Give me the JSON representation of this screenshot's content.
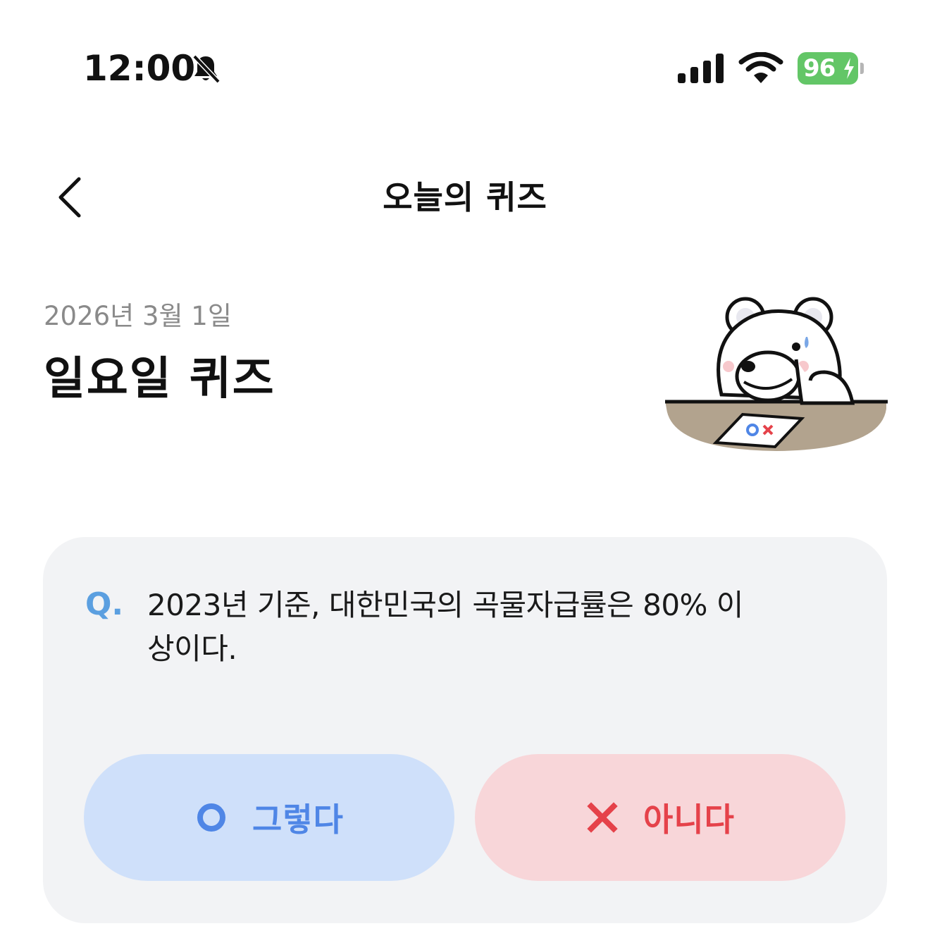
{
  "status_bar": {
    "time": "12:00",
    "battery_percent": "96",
    "icons": [
      "bell-slash-icon",
      "cellular-signal-icon",
      "wifi-icon",
      "battery-charging-icon"
    ],
    "battery_color": "#63c667"
  },
  "header": {
    "title": "오늘의 퀴즈",
    "back_icon": "chevron-left-icon"
  },
  "quiz": {
    "date": "2026년 3월 1일",
    "title": "일요일 퀴즈",
    "mascot_icon": "polar-bear-mascot",
    "question_prefix": "Q.",
    "question": "2023년 기준, 대한민국의 곡물자급률은 80% 이상이다.",
    "options": [
      {
        "icon": "circle-o-icon",
        "label": "그렇다",
        "color": "#4f86e6",
        "background": "#cfe0fa"
      },
      {
        "icon": "x-mark-icon",
        "label": "아니다",
        "color": "#e5424a",
        "background": "#f8d6d9"
      }
    ],
    "card_background": "#f2f3f5",
    "accent_color": "#5b9fe0"
  }
}
